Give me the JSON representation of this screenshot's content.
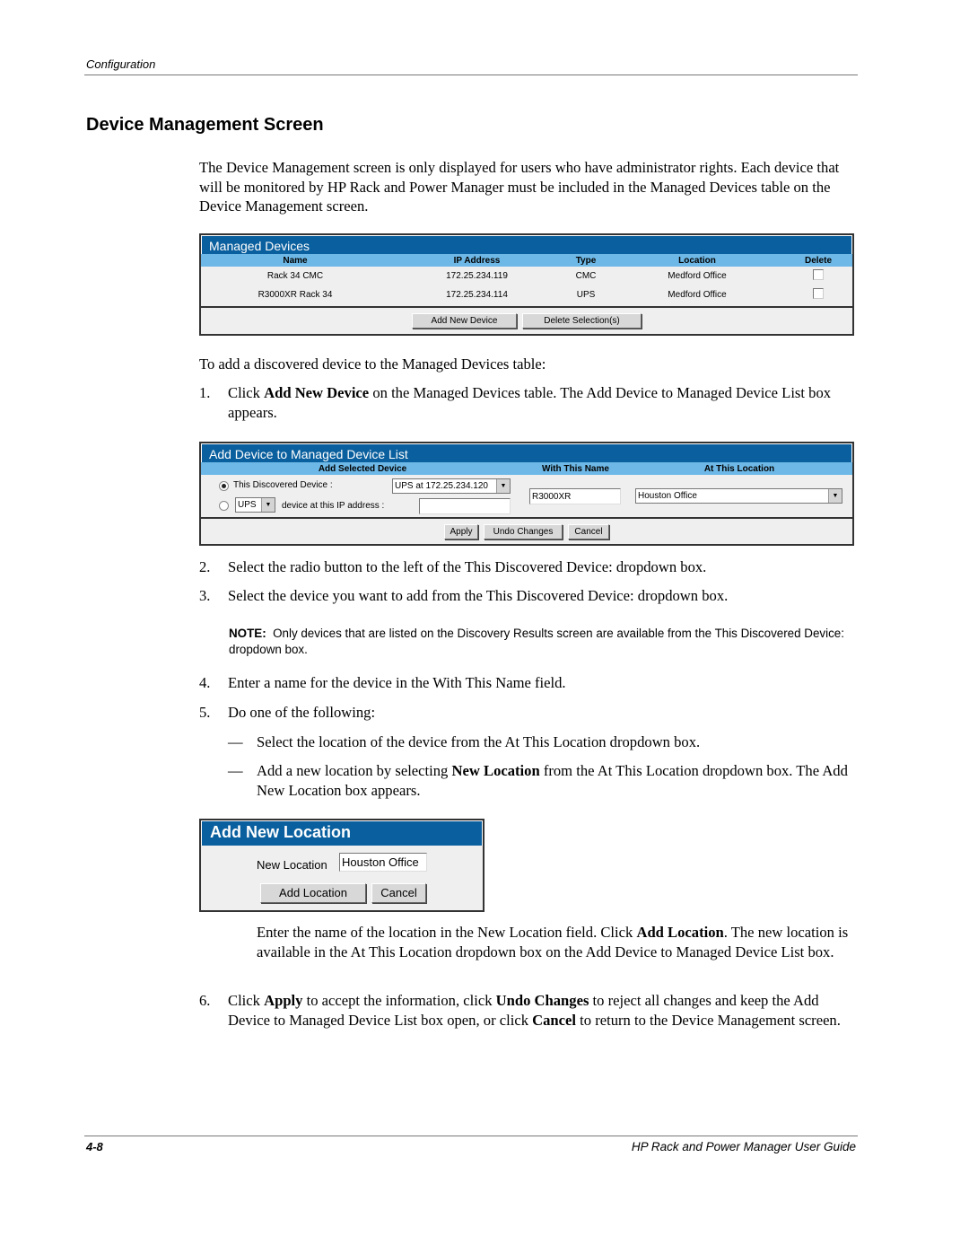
{
  "header": {
    "running_head": "Configuration"
  },
  "section_title": "Device Management Screen",
  "intro": "The Device Management screen is only displayed for users who have administrator rights. Each device that will be monitored by HP Rack and Power Manager must be included in the Managed Devices table on the Device Management screen.",
  "managed_devices": {
    "title": "Managed Devices",
    "columns": [
      "Name",
      "IP Address",
      "Type",
      "Location",
      "Delete"
    ],
    "rows": [
      {
        "name": "Rack 34 CMC",
        "ip": "172.25.234.119",
        "type": "CMC",
        "location": "Medford Office",
        "delete": false
      },
      {
        "name": "R3000XR Rack 34",
        "ip": "172.25.234.114",
        "type": "UPS",
        "location": "Medford Office",
        "delete": false
      }
    ],
    "add_button": "Add New Device",
    "delete_button": "Delete Selection(s)"
  },
  "add_intro": "To add a discovered device to the Managed Devices table:",
  "step1": {
    "num": "1.",
    "pre": "Click ",
    "bold": "Add New Device",
    "post": " on the Managed Devices table. The Add Device to Managed Device List box appears."
  },
  "add_device": {
    "title": "Add Device to Managed Device List",
    "columns": [
      "Add Selected Device",
      "With This Name",
      "At This Location"
    ],
    "option1_label": "This Discovered Device :",
    "option1_selected": true,
    "discovered_value": "UPS at 172.25.234.120",
    "type_value": "UPS",
    "option2_label": "device at this IP address :",
    "ip_value": "",
    "name_value": "R3000XR",
    "location_value": "Houston Office",
    "apply_button": "Apply",
    "undo_button": "Undo Changes",
    "cancel_button": "Cancel"
  },
  "step2": {
    "num": "2.",
    "text": "Select the radio button to the left of the This Discovered Device: dropdown box."
  },
  "step3": {
    "num": "3.",
    "text": "Select the device you want to add from the This Discovered Device: dropdown box."
  },
  "note": {
    "label": "NOTE:",
    "text": "Only devices that are listed on the Discovery Results screen are available from the This Discovered Device: dropdown box."
  },
  "step4": {
    "num": "4.",
    "text": "Enter a name for the device in the With This Name field."
  },
  "step5": {
    "num": "5.",
    "text": "Do one of the following:"
  },
  "dash1": {
    "mark": "—",
    "text": "Select the location of the device from the At This Location dropdown box."
  },
  "dash2": {
    "mark": "—",
    "pre": "Add a new location by selecting ",
    "bold": "New Location",
    "post": " from the At This Location dropdown box. The Add New Location box appears."
  },
  "add_location": {
    "title": "Add New Location",
    "field_label": "New Location",
    "field_value": "Houston Office",
    "add_button": "Add Location",
    "cancel_button": "Cancel"
  },
  "location_para": {
    "pre": "Enter the name of the location in the New Location field. Click ",
    "bold": "Add Location",
    "post": ". The new location is available in the At This Location dropdown box on the Add Device to Managed Device List box."
  },
  "step6": {
    "num": "6.",
    "t1": "Click ",
    "b1": "Apply",
    "t2": " to accept the information, click ",
    "b2": "Undo Changes",
    "t3": " to reject all changes and keep the Add Device to Managed Device List box open, or click ",
    "b3": "Cancel",
    "t4": " to return to the Device Management screen."
  },
  "footer": {
    "page_number": "4-8",
    "book_title": "HP Rack and Power Manager User Guide"
  }
}
